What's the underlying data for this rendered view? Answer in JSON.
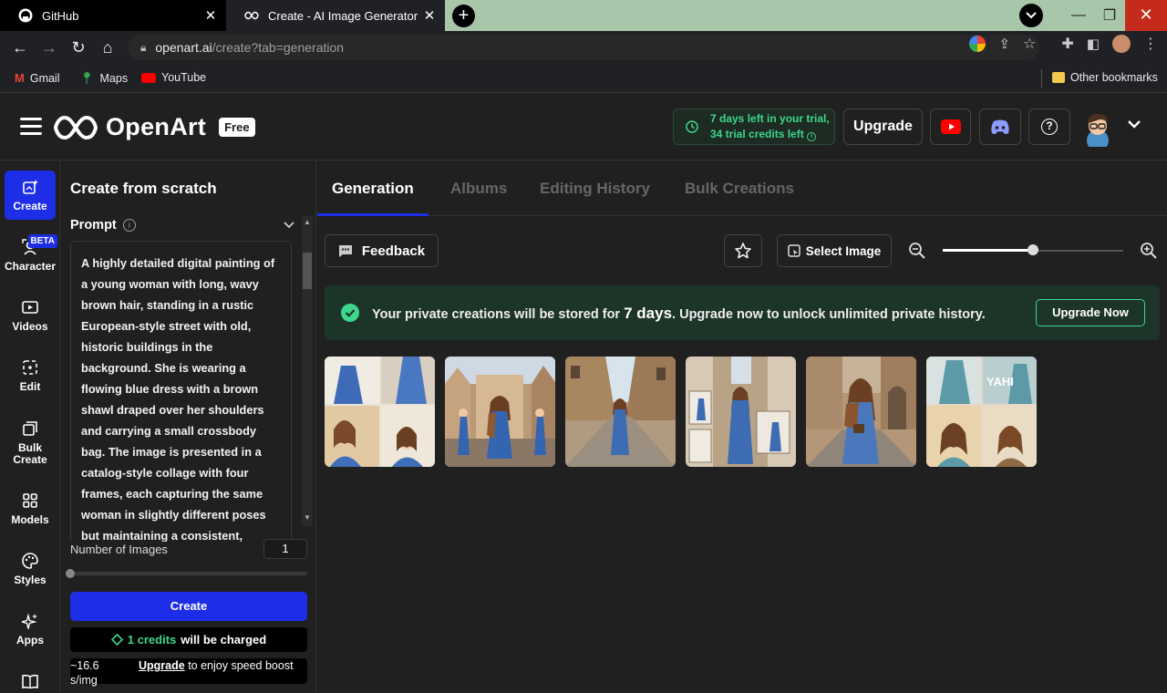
{
  "browser": {
    "tabs": [
      {
        "title": "GitHub",
        "active": false
      },
      {
        "title": "Create - AI Image Generator | Cre",
        "active": true
      }
    ],
    "url_host": "openart.ai",
    "url_path": "/create?tab=generation",
    "bookmarks": [
      "Gmail",
      "Maps",
      "YouTube"
    ],
    "other_bookmarks": "Other bookmarks"
  },
  "header": {
    "brand": "OpenArt",
    "plan_badge": "Free",
    "trial_line1": "7 days left in your trial,",
    "trial_line2": "34 trial credits left",
    "upgrade_label": "Upgrade"
  },
  "rail": [
    {
      "label": "Create",
      "icon": "create-icon",
      "active": true
    },
    {
      "label": "Character",
      "icon": "character-icon",
      "badge": "BETA"
    },
    {
      "label": "Videos",
      "icon": "video-icon"
    },
    {
      "label": "Edit",
      "icon": "edit-icon"
    },
    {
      "label": "Bulk Create",
      "icon": "bulk-icon"
    },
    {
      "label": "Models",
      "icon": "grid-icon"
    },
    {
      "label": "Styles",
      "icon": "palette-icon"
    },
    {
      "label": "Apps",
      "icon": "sparkle-icon"
    }
  ],
  "panel": {
    "title": "Create from scratch",
    "prompt_label": "Prompt",
    "prompt_text": "A highly detailed digital painting of a young woman with long, wavy brown hair, standing in a rustic European-style street with old, historic buildings in the background. She is wearing a flowing blue dress with a brown shawl draped over her shoulders and carrying a small crossbody bag. The image is presented in a catalog-style collage with four frames, each capturing the same woman in slightly different poses but maintaining a consistent,",
    "num_images_label": "Number of Images",
    "num_images_value": "1",
    "num_images_fraction": 0,
    "create_label": "Create",
    "credits_strong": "1 credits",
    "credits_rest": "will be charged",
    "speed_value": "~16.6 s/img",
    "speed_upgrade": "Upgrade",
    "speed_rest": "to enjoy speed boost"
  },
  "main": {
    "tabs": [
      "Generation",
      "Albums",
      "Editing History",
      "Bulk Creations"
    ],
    "active_tab": "Generation",
    "feedback_label": "Feedback",
    "select_image_label": "Select Image",
    "zoom_fraction": 0.5,
    "banner_pre": "Your private creations will be stored for",
    "banner_days": "7 days",
    "banner_post": ". Upgrade now to unlock unlimited private history.",
    "banner_button": "Upgrade Now",
    "thumbnail_watermark": "YAHI",
    "accent": "#1e2ee6",
    "success": "#3dd68c"
  }
}
